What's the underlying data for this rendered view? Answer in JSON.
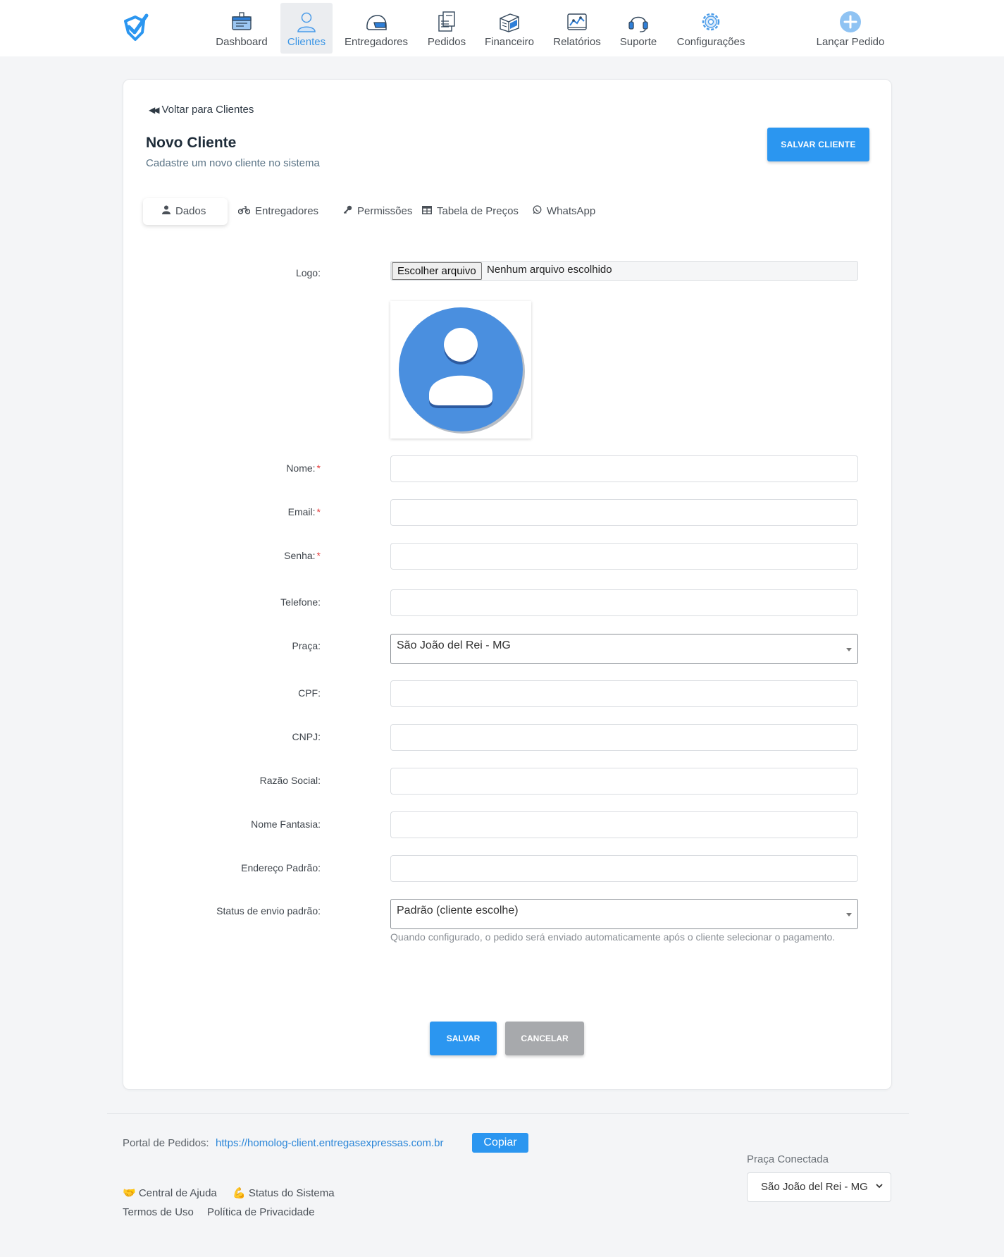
{
  "nav": {
    "items": [
      {
        "label": "Dashboard",
        "icon": "dashboard-icon",
        "active": false
      },
      {
        "label": "Clientes",
        "icon": "user-icon",
        "active": true
      },
      {
        "label": "Entregadores",
        "icon": "helmet-icon",
        "active": false
      },
      {
        "label": "Pedidos",
        "icon": "orders-icon",
        "active": false
      },
      {
        "label": "Financeiro",
        "icon": "money-icon",
        "active": false
      },
      {
        "label": "Relatórios",
        "icon": "chart-icon",
        "active": false
      },
      {
        "label": "Suporte",
        "icon": "headset-icon",
        "active": false
      },
      {
        "label": "Configurações",
        "icon": "gear-icon",
        "active": false
      },
      {
        "label": "Lançar Pedido",
        "icon": "plus-circle-icon",
        "active": false
      }
    ]
  },
  "header": {
    "back_label": "Voltar para Clientes",
    "title": "Novo Cliente",
    "subtitle": "Cadastre um novo cliente no sistema",
    "save_top_label": "SALVAR CLIENTE"
  },
  "tabs": [
    {
      "label": "Dados",
      "icon": "user-icon",
      "active": true
    },
    {
      "label": "Entregadores",
      "icon": "motorcycle-icon",
      "active": false
    },
    {
      "label": "Permissões",
      "icon": "key-icon",
      "active": false
    },
    {
      "label": "Tabela de Preços",
      "icon": "table-icon",
      "active": false
    },
    {
      "label": "WhatsApp",
      "icon": "whatsapp-icon",
      "active": false
    }
  ],
  "form": {
    "logo_label": "Logo:",
    "file_button": "Escolher arquivo",
    "file_none": "Nenhum arquivo escolhido",
    "nome_label": "Nome:",
    "email_label": "Email:",
    "senha_label": "Senha:",
    "telefone_label": "Telefone:",
    "praca_label": "Praça:",
    "praca_value": "São João del Rei - MG",
    "cpf_label": "CPF:",
    "cnpj_label": "CNPJ:",
    "razao_label": "Razão Social:",
    "fantasia_label": "Nome Fantasia:",
    "endereco_label": "Endereço Padrão:",
    "status_label": "Status de envio padrão:",
    "status_value": "Padrão (cliente escolhe)",
    "status_help": "Quando configurado, o pedido será enviado automaticamente após o cliente selecionar o pagamento.",
    "required_mark": "*",
    "save_label": "SALVAR",
    "cancel_label": "CANCELAR"
  },
  "footer": {
    "portal_label": "Portal de Pedidos:",
    "portal_url": "https://homolog-client.entregasexpressas.com.br",
    "copy_label": "Copiar",
    "help_label": "🤝 Central de Ajuda",
    "status_label": "💪 Status do Sistema",
    "terms_label": "Termos de Uso",
    "privacy_label": "Política de Privacidade",
    "praca_label": "Praça Conectada",
    "praca_value": "São João del Rei - MG"
  },
  "colors": {
    "accent": "#2b96f0",
    "active_nav": "#3a95e5",
    "required": "#e53b3b",
    "cancel": "#a7a9ac",
    "avatar": "#4a8fdf"
  }
}
